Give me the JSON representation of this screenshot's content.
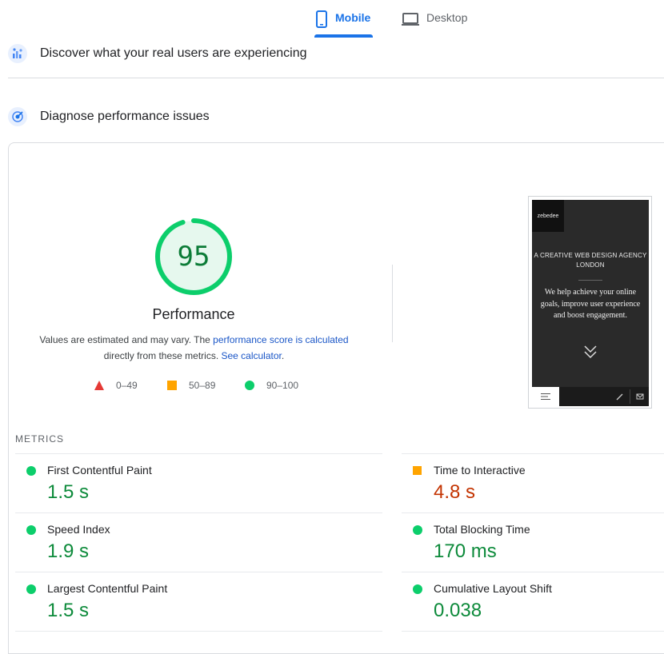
{
  "tabs": [
    {
      "label": "Mobile",
      "active": true,
      "icon": "phone-icon"
    },
    {
      "label": "Desktop",
      "active": false,
      "icon": "laptop-icon"
    }
  ],
  "sections": {
    "field": "Discover what your real users are experiencing",
    "lab": "Diagnose performance issues"
  },
  "performance": {
    "score": "95",
    "score_fraction": 0.95,
    "title": "Performance",
    "desc_1": "Values are estimated and may vary. The ",
    "link_1": "performance score is calculated",
    "desc_2": "directly from these metrics. ",
    "link_2": "See calculator",
    "desc_3": "."
  },
  "legend": [
    {
      "range": "0–49",
      "shape": "triangle",
      "color": "#e53935"
    },
    {
      "range": "50–89",
      "shape": "square",
      "color": "#ffa400"
    },
    {
      "range": "90–100",
      "shape": "circle",
      "color": "#0cce6b"
    }
  ],
  "preview": {
    "logo": "zebedee",
    "heading_1": "A CREATIVE WEB DESIGN AGENCY",
    "heading_2": "LONDON",
    "body": "We help achieve your online goals, improve user experience and boost engagement."
  },
  "metrics_label": "METRICS",
  "metrics": [
    {
      "name": "First Contentful Paint",
      "value": "1.5 s",
      "rating": "good"
    },
    {
      "name": "Time to Interactive",
      "value": "4.8 s",
      "rating": "average"
    },
    {
      "name": "Speed Index",
      "value": "1.9 s",
      "rating": "good"
    },
    {
      "name": "Total Blocking Time",
      "value": "170 ms",
      "rating": "good"
    },
    {
      "name": "Largest Contentful Paint",
      "value": "1.5 s",
      "rating": "good"
    },
    {
      "name": "Cumulative Layout Shift",
      "value": "0.038",
      "rating": "good"
    }
  ],
  "colors": {
    "accent": "#1a73e8",
    "good": "#0cce6b",
    "good_text": "#0c8a3a",
    "average": "#ffa400",
    "average_text": "#c33300",
    "poor": "#e53935"
  }
}
